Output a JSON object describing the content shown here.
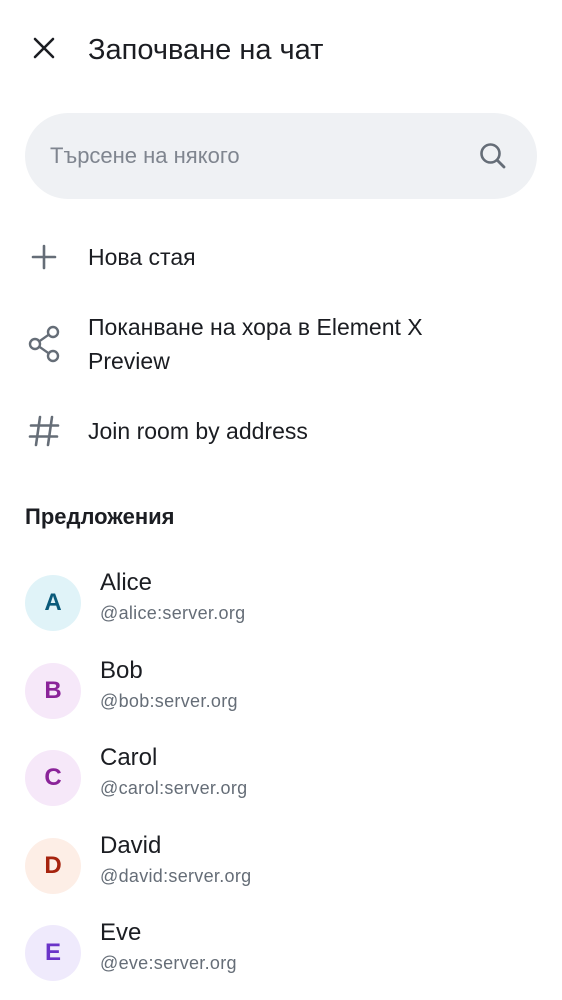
{
  "header": {
    "title": "Започване на чат"
  },
  "search": {
    "placeholder": "Търсене на някого"
  },
  "actions": [
    {
      "label": "Нова стая",
      "icon": "plus-icon"
    },
    {
      "label": "Поканване на хора в Element X Preview",
      "icon": "share-icon"
    },
    {
      "label": "Join room by address",
      "icon": "hash-icon"
    }
  ],
  "suggestions_section": {
    "title": "Предложения"
  },
  "suggestions": [
    {
      "initial": "A",
      "name": "Alice",
      "id": "@alice:server.org",
      "avatar_bg": "#e0f3f8",
      "avatar_fg": "#0a5a7a"
    },
    {
      "initial": "B",
      "name": "Bob",
      "id": "@bob:server.org",
      "avatar_bg": "#f6e8f9",
      "avatar_fg": "#8a2399"
    },
    {
      "initial": "C",
      "name": "Carol",
      "id": "@carol:server.org",
      "avatar_bg": "#f6e8f9",
      "avatar_fg": "#8a2399"
    },
    {
      "initial": "D",
      "name": "David",
      "id": "@david:server.org",
      "avatar_bg": "#fdeee6",
      "avatar_fg": "#a6230e"
    },
    {
      "initial": "E",
      "name": "Eve",
      "id": "@eve:server.org",
      "avatar_bg": "#efeafc",
      "avatar_fg": "#6a34c8"
    }
  ],
  "colors": {
    "text_primary": "#1b1d22",
    "text_secondary": "#656d77",
    "search_bg": "#eff1f4",
    "icon": "#656d77"
  }
}
